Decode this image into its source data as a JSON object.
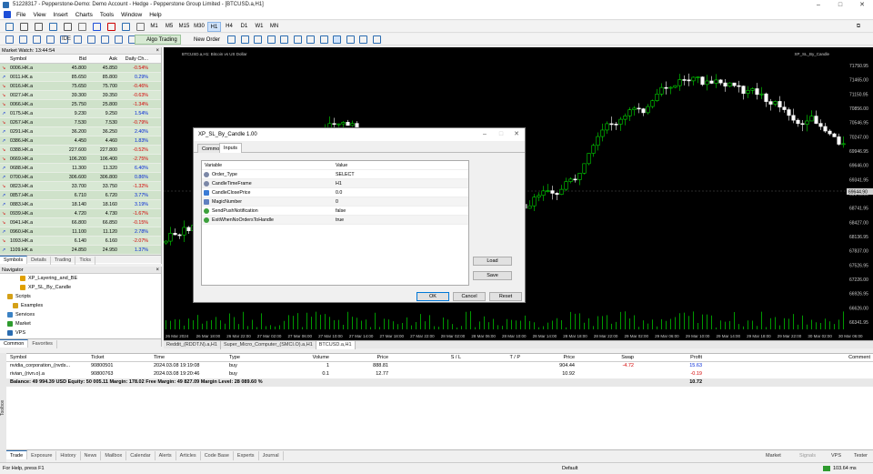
{
  "window": {
    "title": "51228317 - Pepperstone-Demo: Demo Account - Hedge - Pepperstone Group Limited - [BTCUSD.a,H1]"
  },
  "menu": [
    "File",
    "View",
    "Insert",
    "Charts",
    "Tools",
    "Window",
    "Help"
  ],
  "timeframes": [
    "M1",
    "M5",
    "M15",
    "M30",
    "H1",
    "H4",
    "D1",
    "W1",
    "MN"
  ],
  "active_tf": "H1",
  "toolbar": {
    "algo_label": "Algo Trading",
    "new_order_label": "New Order",
    "ide_label": "IDE"
  },
  "market_watch": {
    "title": "Market Watch: 13:44:54",
    "headers": {
      "symbol": "Symbol",
      "bid": "Bid",
      "ask": "Ask",
      "chg": "Daily Ch..."
    },
    "rows": [
      {
        "s": "0006.HK.a",
        "b": "45.800",
        "a": "45.850",
        "c": "-0.54%"
      },
      {
        "s": "0011.HK.a",
        "b": "85.650",
        "a": "85.800",
        "c": "0.29%"
      },
      {
        "s": "0016.HK.a",
        "b": "75.650",
        "a": "75.700",
        "c": "-0.46%"
      },
      {
        "s": "0027.HK.a",
        "b": "39.300",
        "a": "39.350",
        "c": "-0.63%"
      },
      {
        "s": "0066.HK.a",
        "b": "25.750",
        "a": "25.800",
        "c": "-1.34%"
      },
      {
        "s": "0175.HK.a",
        "b": "9.230",
        "a": "9.250",
        "c": "1.54%"
      },
      {
        "s": "0267.HK.a",
        "b": "7.530",
        "a": "7.530",
        "c": "-0.79%"
      },
      {
        "s": "0291.HK.a",
        "b": "36.200",
        "a": "36.250",
        "c": "2.40%"
      },
      {
        "s": "0386.HK.a",
        "b": "4.450",
        "a": "4.460",
        "c": "1.83%"
      },
      {
        "s": "0388.HK.a",
        "b": "227.600",
        "a": "227.800",
        "c": "-0.52%"
      },
      {
        "s": "0669.HK.a",
        "b": "106.200",
        "a": "106.400",
        "c": "-2.75%"
      },
      {
        "s": "0688.HK.a",
        "b": "11.300",
        "a": "11.320",
        "c": "6.40%"
      },
      {
        "s": "0700.HK.a",
        "b": "306.600",
        "a": "306.800",
        "c": "0.86%"
      },
      {
        "s": "0823.HK.a",
        "b": "33.700",
        "a": "33.750",
        "c": "-1.32%"
      },
      {
        "s": "0857.HK.a",
        "b": "6.710",
        "a": "6.720",
        "c": "3.77%"
      },
      {
        "s": "0883.HK.a",
        "b": "18.140",
        "a": "18.160",
        "c": "3.19%"
      },
      {
        "s": "0939.HK.a",
        "b": "4.720",
        "a": "4.730",
        "c": "-1.67%"
      },
      {
        "s": "0941.HK.a",
        "b": "66.800",
        "a": "66.850",
        "c": "-0.15%"
      },
      {
        "s": "0960.HK.a",
        "b": "11.100",
        "a": "11.120",
        "c": "2.78%"
      },
      {
        "s": "1093.HK.a",
        "b": "6.140",
        "a": "6.160",
        "c": "-2.07%"
      },
      {
        "s": "1109.HK.a",
        "b": "24.850",
        "a": "24.950",
        "c": "1.37%"
      }
    ],
    "tabs": [
      "Symbols",
      "Details",
      "Trading",
      "Ticks"
    ]
  },
  "navigator": {
    "title": "Navigator",
    "items": [
      "XP_Layering_and_BE",
      "XP_SL_By_Candle",
      "Scripts",
      "Examples",
      "Services",
      "Market",
      "VPS"
    ],
    "tabs": [
      "Common",
      "Favorites"
    ]
  },
  "chart": {
    "label": "BTCUSD.a,H1: Bitcoin vs US Dollar",
    "ea_label": "XP_SL_By_Candle",
    "price_labels": [
      "71750.95",
      "71465.00",
      "71150.95",
      "70856.00",
      "70546.95",
      "70247.00",
      "69946.95",
      "69646.00",
      "69341.95",
      "69046.00",
      "68741.95",
      "68427.00",
      "68136.95",
      "67837.00",
      "67526.95",
      "67226.00",
      "66926.95",
      "66626.00",
      "66341.95"
    ],
    "current_price": "69644.90",
    "time_labels": [
      "26 Mar 2024",
      "26 Mar 18:00",
      "26 Mar 22:00",
      "27 Mar 02:00",
      "27 Mar 06:00",
      "27 Mar 10:00",
      "27 Mar 14:00",
      "27 Mar 18:00",
      "27 Mar 22:00",
      "28 Mar 02:00",
      "28 Mar 06:00",
      "28 Mar 10:00",
      "28 Mar 14:00",
      "28 Mar 18:00",
      "28 Mar 22:00",
      "29 Mar 02:00",
      "29 Mar 06:00",
      "29 Mar 10:00",
      "29 Mar 14:00",
      "29 Mar 18:00",
      "29 Mar 22:00",
      "30 Mar 02:00",
      "30 Mar 06:00"
    ],
    "tabs": [
      "Reddit_(RDDT.N).a,H1",
      "Super_Micro_Computer_(SMCI.O).a,H1",
      "BTCUSD.a,H1"
    ],
    "active_tab": "BTCUSD.a,H1",
    "colors": {
      "up": "#00e000",
      "down": "#ffffff",
      "bg": "#000000"
    }
  },
  "dialog": {
    "title": "XP_SL_By_Candle 1.00",
    "tabs": [
      "Common",
      "Inputs"
    ],
    "header": {
      "variable": "Variable",
      "value": "Value"
    },
    "params": [
      {
        "name": "Order_Type",
        "value": "SELECT",
        "icon": "enum"
      },
      {
        "name": "CandleTimeFrame",
        "value": "H1",
        "icon": "enum"
      },
      {
        "name": "CandleClosePrice",
        "value": "0.0",
        "icon": "double"
      },
      {
        "name": "MagicNumber",
        "value": "0",
        "icon": "int"
      },
      {
        "name": "SendPushNotification",
        "value": "false",
        "icon": "bool"
      },
      {
        "name": "ExitWhenNoOrdersToHandle",
        "value": "true",
        "icon": "bool"
      }
    ],
    "load": "Load",
    "save": "Save",
    "ok": "OK",
    "cancel": "Cancel",
    "reset": "Reset"
  },
  "trade": {
    "headers": [
      "Symbol",
      "Ticket",
      "Time",
      "Type",
      "Volume",
      "Price",
      "S / L",
      "T / P",
      "Price",
      "Swap",
      "Profit",
      "Comment"
    ],
    "rows": [
      [
        "nvidia_corporation_(nvds...",
        "90800501",
        "2024.03.08 19:19:08",
        "buy",
        "1",
        "888.81",
        "",
        "",
        "904.44",
        "-4.72",
        "15.63",
        ""
      ],
      [
        "rivian_(rivn.o).a",
        "90800763",
        "2024.03.08 19:20:46",
        "buy",
        "0.1",
        "12.77",
        "",
        "",
        "10.92",
        "",
        "-0.19",
        ""
      ]
    ],
    "balance": "Balance: 49 994.39 USD  Equity: 50 005.11  Margin: 178.02  Free Margin: 49 827.09  Margin Level: 28 089.60 %",
    "balance_profit": "10.72",
    "tabs": [
      "Trade",
      "Exposure",
      "History",
      "News",
      "Mailbox",
      "Calendar",
      "Alerts",
      "Articles",
      "Code Base",
      "Experts",
      "Journal"
    ],
    "right_tabs": [
      "Market",
      "Signals",
      "VPS",
      "Tester"
    ],
    "toolbox": "Toolbox"
  },
  "status": {
    "left": "For Help, press F1",
    "mid": "Default",
    "right": "103.64 ms"
  }
}
